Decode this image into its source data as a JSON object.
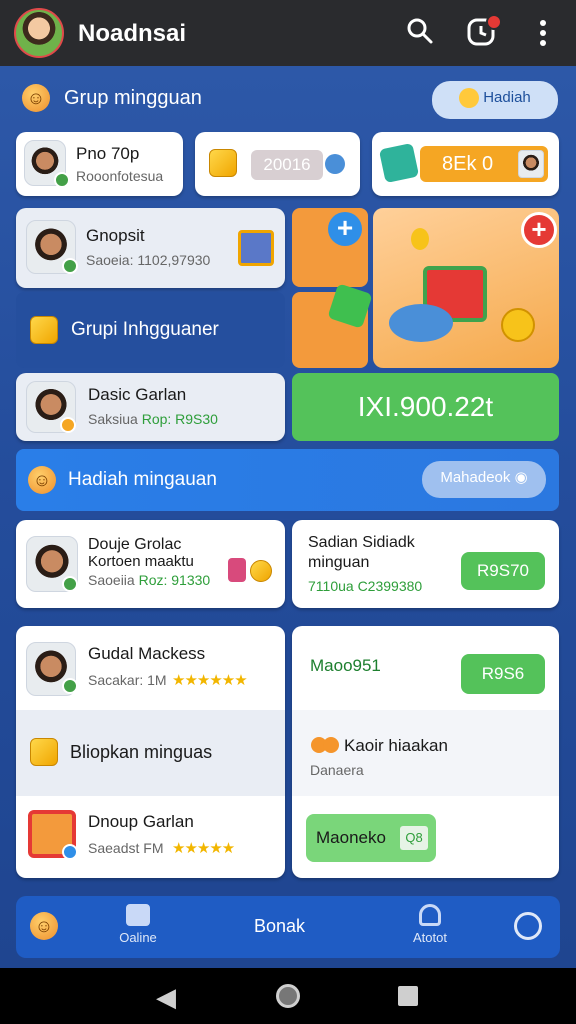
{
  "topbar": {
    "title": "Noadnsai",
    "icons": [
      "avatar",
      "search-icon",
      "clock-icon",
      "more-vertical-icon"
    ]
  },
  "section1": {
    "title": "Grup mingguan",
    "button_label": "Hadiah"
  },
  "row1": {
    "card_left": {
      "title": "Pno 70p",
      "subtitle": "Rooonfotesua"
    },
    "card_mid": {
      "value": "20016"
    },
    "card_right": {
      "value": "8Ek 0"
    }
  },
  "row2": {
    "card_left": {
      "title": "Gnopsit",
      "subtitle": "Saoeia: 1102,97930"
    },
    "group_label": "Grupi Inhgguaner"
  },
  "row3": {
    "card_left": {
      "title": "Dasic Garlan",
      "subtitle_prefix": "Saksiua",
      "subtitle_value": "Rop: R9S30"
    },
    "amount_label": "IXI.900.22t"
  },
  "banner": {
    "title": "Hadiah mingauan",
    "button_label": "Mahadeok"
  },
  "row4": {
    "card_left": {
      "title": "Douje Grolac",
      "title2": "Kortoen maaktu",
      "subtitle_prefix": "Saoeiia",
      "subtitle_value": "Roz: 91330"
    },
    "card_right": {
      "title": "Sadian Sidiadk",
      "title2": "minguan",
      "subtitle": "7110ua C2399380",
      "button_label": "R9S70"
    }
  },
  "row5": {
    "item1": {
      "title": "Gudal Mackess",
      "subtitle": "Sacakar: 1M"
    },
    "item2": {
      "title": "Bliopkan minguas"
    },
    "item3": {
      "title": "Dnoup Garlan",
      "subtitle": "Saeadst FM"
    },
    "right1": {
      "title": "Maoo951",
      "button_label": "R9S6"
    },
    "right2": {
      "title": "Kaoir hiaakan",
      "subtitle": "Danaera"
    },
    "right3": {
      "button_label": "Maoneko",
      "chip": "Q8"
    }
  },
  "bottom_nav": {
    "items": [
      {
        "label": "",
        "icon": "smile-icon"
      },
      {
        "label": "Oaline",
        "icon": "grid-icon"
      },
      {
        "label": "Bonak",
        "icon": ""
      },
      {
        "label": "Atotot",
        "icon": "user-icon"
      },
      {
        "label": "",
        "icon": "compass-icon"
      }
    ]
  },
  "colors": {
    "accent_blue": "#1f5cc4",
    "green": "#54c25a",
    "orange": "#f5a623"
  }
}
